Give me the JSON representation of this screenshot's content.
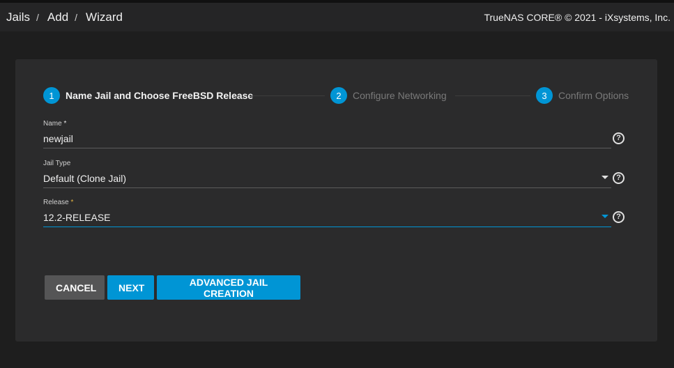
{
  "header": {
    "breadcrumbs": [
      "Jails",
      "Add",
      "Wizard"
    ],
    "separator": "/",
    "copyright": "TrueNAS CORE® © 2021 - iXsystems, Inc."
  },
  "stepper": {
    "steps": [
      {
        "number": "1",
        "label": "Name Jail and Choose FreeBSD Release",
        "state": "active"
      },
      {
        "number": "2",
        "label": "Configure Networking",
        "state": "inactive"
      },
      {
        "number": "3",
        "label": "Confirm Options",
        "state": "inactive"
      }
    ]
  },
  "form": {
    "name": {
      "label": "Name",
      "required_mark": "*",
      "value": "newjail"
    },
    "jail_type": {
      "label": "Jail Type",
      "value": "Default (Clone Jail)"
    },
    "release": {
      "label": "Release",
      "required_mark": "*",
      "value": "12.2-RELEASE"
    },
    "help_glyph": "?"
  },
  "buttons": {
    "cancel": "CANCEL",
    "next": "NEXT",
    "advanced": "ADVANCED JAIL CREATION"
  },
  "colors": {
    "accent": "#0095d5",
    "card_bg": "#2b2b2c",
    "page_bg": "#1e1e1e",
    "header_bg": "#252526",
    "required_highlight": "#e3b341"
  },
  "icons": [
    "help-circle-icon",
    "dropdown-caret-icon"
  ]
}
